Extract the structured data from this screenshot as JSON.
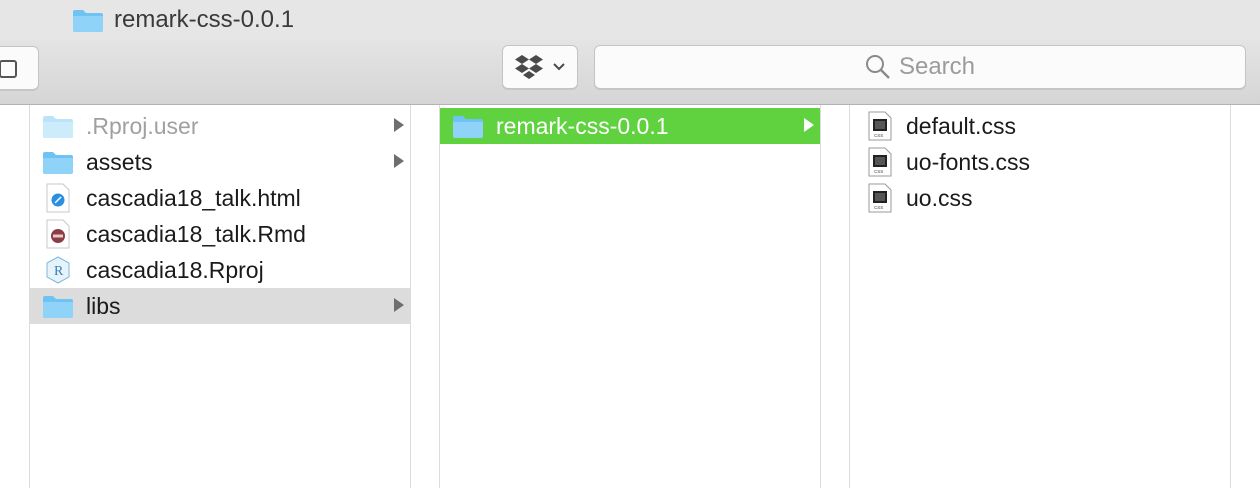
{
  "window": {
    "title": "remark-css-0.0.1"
  },
  "toolbar": {
    "search_placeholder": "Search",
    "dropbox_icon": "dropbox-icon",
    "view_icon": "view-icon"
  },
  "column1": {
    "items": [
      {
        "label": ".Rproj.user",
        "icon": "folder-icon",
        "has_arrow": true,
        "state": "dim"
      },
      {
        "label": "assets",
        "icon": "folder-icon",
        "has_arrow": true,
        "state": "normal"
      },
      {
        "label": "cascadia18_talk.html",
        "icon": "safari-html-icon",
        "has_arrow": false,
        "state": "normal"
      },
      {
        "label": "cascadia18_talk.Rmd",
        "icon": "rmd-icon",
        "has_arrow": false,
        "state": "normal"
      },
      {
        "label": "cascadia18.Rproj",
        "icon": "rproj-icon",
        "has_arrow": false,
        "state": "normal"
      },
      {
        "label": "libs",
        "icon": "folder-icon",
        "has_arrow": true,
        "state": "selected-inactive"
      }
    ]
  },
  "column2": {
    "items": [
      {
        "label": "remark-css-0.0.1",
        "icon": "folder-icon",
        "has_arrow": true,
        "state": "selected"
      }
    ]
  },
  "column3": {
    "items": [
      {
        "label": "default.css",
        "icon": "css-file-icon"
      },
      {
        "label": "uo-fonts.css",
        "icon": "css-file-icon"
      },
      {
        "label": "uo.css",
        "icon": "css-file-icon"
      }
    ]
  },
  "colors": {
    "selection": "#61d23f",
    "inactive_selection": "#dcdcdc",
    "folder": "#6fc3f2"
  }
}
